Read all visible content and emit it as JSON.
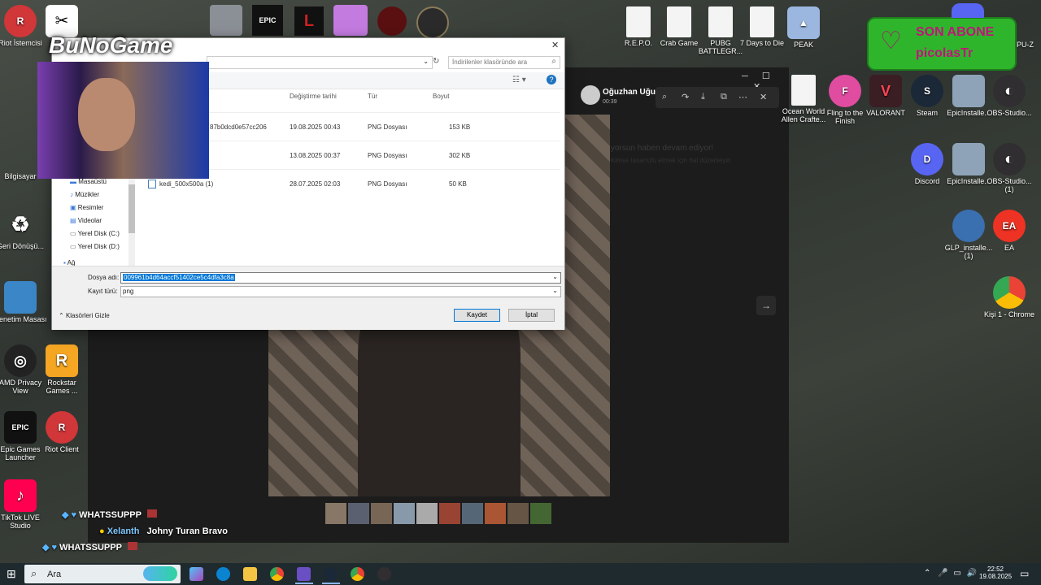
{
  "desktop_icons_left": [
    {
      "label": "Riot İstemcisi",
      "color": "#d13639",
      "glyph": "R"
    },
    {
      "label": "Bilgisayar",
      "color": "#3a7bd5",
      "glyph": ""
    },
    {
      "label": "Geri Dönüşü...",
      "color": "#8aa6b8",
      "glyph": "♻"
    },
    {
      "label": "Denetim Masası",
      "color": "#3b86c6",
      "glyph": ""
    },
    {
      "label": "AMD Privacy View",
      "color": "#222",
      "glyph": "◎"
    },
    {
      "label": "Rockstar Games ...",
      "color": "#f5a623",
      "glyph": "R"
    },
    {
      "label": "Epic Games Launcher",
      "color": "#111",
      "glyph": "EPIC"
    },
    {
      "label": "Riot Client",
      "color": "#d13639",
      "glyph": "R"
    },
    {
      "label": "TikTok LIVE Studio",
      "color": "#ff0050",
      "glyph": "♪"
    }
  ],
  "desktop_icons_top": [
    {
      "label": "R.E.P.O.",
      "file": true
    },
    {
      "label": "Crab Game",
      "file": true
    },
    {
      "label": "PUBG BATTLEGR...",
      "file": true
    },
    {
      "label": "7 Days to Die",
      "file": true
    },
    {
      "label": "PEAK",
      "color": "#9bb7e0"
    }
  ],
  "desktop_icons_right": [
    {
      "label": "Ocean World Allen Crafte...",
      "file": true
    },
    {
      "label": "Fling to the Finish",
      "color": "#e04ca0",
      "glyph": "F"
    },
    {
      "label": "VALORANT",
      "color": "#3b1e24",
      "glyph": "V"
    },
    {
      "label": "Steam",
      "color": "#1b2838",
      "glyph": "S"
    },
    {
      "label": "EpicInstalle...",
      "color": "#8ea3b8",
      "glyph": ""
    },
    {
      "label": "OBS-Studio...",
      "color": "#302e31",
      "glyph": "◐"
    },
    {
      "label": "Discord",
      "color": "#5865f2",
      "glyph": "D"
    },
    {
      "label": "EpicInstalle...",
      "color": "#8ea3b8",
      "glyph": ""
    },
    {
      "label": "OBS-Studio... (1)",
      "color": "#302e31",
      "glyph": "◐"
    },
    {
      "label": "GLP_installe... (1)",
      "color": "#3a6fb0",
      "glyph": ""
    },
    {
      "label": "EA",
      "color": "#ee3224",
      "glyph": "EA"
    },
    {
      "label": "Kişi 1 - Chrome",
      "color": "#34a853",
      "glyph": "●"
    }
  ],
  "stream_overlay": {
    "logo_text": "BuNoGame",
    "subscriber_title": "SON ABONE",
    "subscriber_name": "picolasTr",
    "top_right_fragment": "PU-Z"
  },
  "viewer": {
    "sender_name": "Oğuzhan Uğur",
    "sender_time": "00:39",
    "faded_text_1": "yorsun haben devam ediyor!",
    "faded_text_2": "Kimse tasarrufu etmek için hal düzenleyin"
  },
  "dialog": {
    "search_placeholder": "İndirilenler klasöründe ara",
    "columns": {
      "modified": "Değiştirme tarihi",
      "type": "Tür",
      "size": "Boyut"
    },
    "files": [
      {
        "name": "87b0dcd0e57cc206",
        "modified": "19.08.2025 00:43",
        "type": "PNG Dosyası",
        "size": "153 KB"
      },
      {
        "name": "",
        "modified": "13.08.2025 00:37",
        "type": "PNG Dosyası",
        "size": "302 KB"
      },
      {
        "name": "kedi_500x500a (1)",
        "modified": "28.07.2025 02:03",
        "type": "PNG Dosyası",
        "size": "50 KB"
      }
    ],
    "nav": [
      "Masaüstü",
      "Müzikler",
      "Resimler",
      "Videolar",
      "Yerel Disk (C:)",
      "Yerel Disk (D:)",
      "Ağ"
    ],
    "filename_label": "Dosya adı:",
    "filename_value": "009961b4d64accf51402ce5c4dfa3c8a",
    "filetype_label": "Kayıt türü:",
    "filetype_value": "png",
    "hide_folders": "Klasörleri Gizle",
    "save": "Kaydet",
    "cancel": "İptal"
  },
  "chat": [
    {
      "user": "WHATSSUPPP",
      "message": ""
    },
    {
      "user": "Xelanth",
      "message": "Johny Turan Bravo",
      "color": "#7ec8ff"
    },
    {
      "user": "WHATSSUPPP",
      "message": ""
    }
  ],
  "taskbar": {
    "search": "Ara",
    "time": "22:52",
    "date": "19.08.2025"
  }
}
